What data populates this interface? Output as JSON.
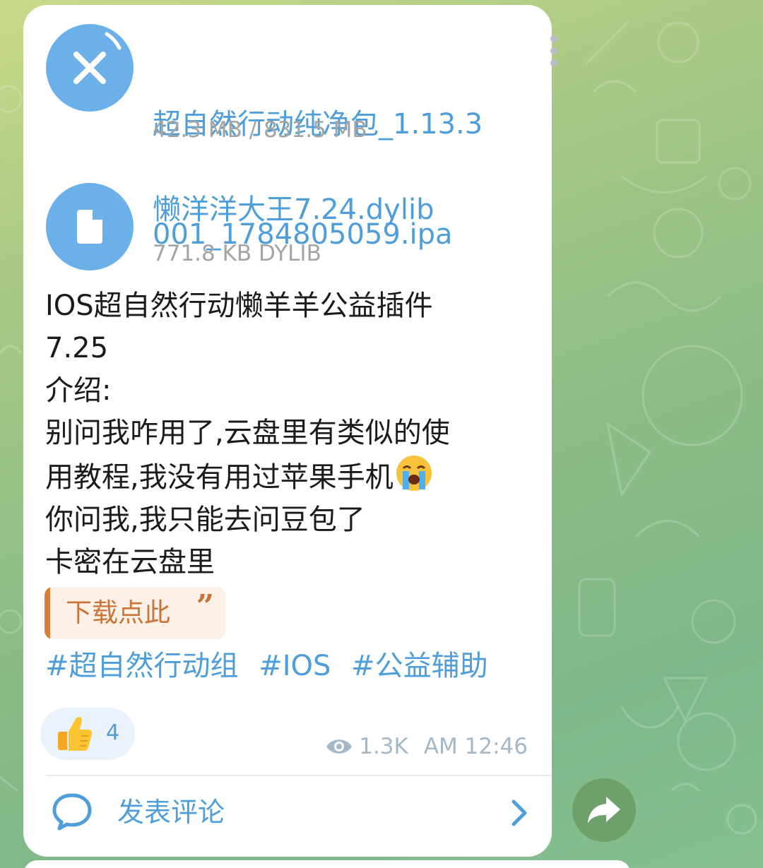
{
  "post": {
    "files": [
      {
        "name": "超自然行动纯净包_1.13.3001_1784805059.ipa",
        "name_line1": "超自然行动纯净包_1.13.3",
        "name_line2": "001_1784805059.ipa",
        "size": "42.3 MB / 831.5 MB",
        "icon": "cancel-download-icon"
      },
      {
        "name": "懒洋洋大王7.24.dylib",
        "size": "771.8 KB DYLIB",
        "icon": "document-icon"
      }
    ],
    "message_lines": [
      "IOS超自然行动懒羊羊公益插件",
      "7.25",
      "介绍:",
      "别问我咋用了,云盘里有类似的使",
      "用教程,我没有用过苹果手机",
      "你问我,我只能去问豆包了",
      "卡密在云盘里"
    ],
    "emoji_after_line5": "loudly-crying-face-emoji",
    "quote_link": "下载点此",
    "quote_mark": "”",
    "hashtags": [
      "#超自然行动组",
      "#IOS",
      "#公益辅助"
    ],
    "reaction": {
      "emoji": "thumbs-up-emoji",
      "count": "4"
    },
    "views": "1.3K",
    "time": "AM 12:46",
    "comment_label": "发表评论"
  },
  "colors": {
    "link": "#4e9ed9",
    "file_icon_bg": "#6cb0ea",
    "quote_accent": "#d97f35",
    "quote_bg": "#fdf0e6",
    "share_button": "#6ea06a",
    "meta_text": "#a4b8c8"
  }
}
